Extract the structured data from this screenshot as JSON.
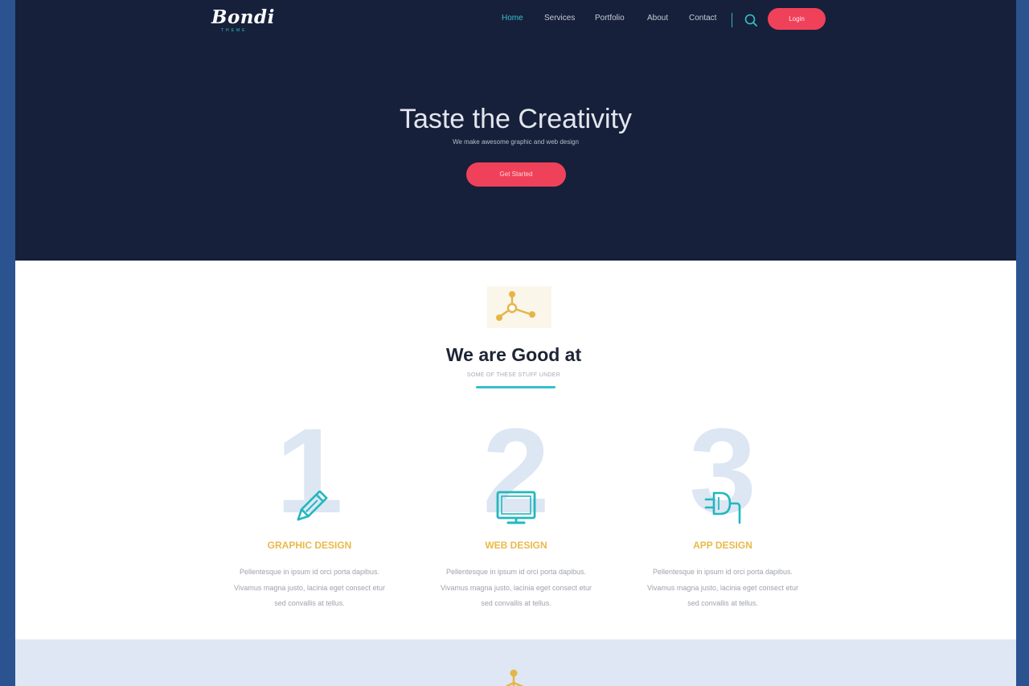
{
  "brand": {
    "name": "Bondi",
    "tagline": "THEME"
  },
  "nav": {
    "items": [
      {
        "label": "Home",
        "active": true
      },
      {
        "label": "Services",
        "active": false
      },
      {
        "label": "Portfolio",
        "active": false
      },
      {
        "label": "About",
        "active": false
      },
      {
        "label": "Contact",
        "active": false
      }
    ],
    "search_icon": "search-icon",
    "login_label": "Login"
  },
  "hero": {
    "title": "Taste the Creativity",
    "subtitle": "We make awesome graphic and web design",
    "cta_label": "Get Started"
  },
  "services": {
    "icon": "network-nodes-icon",
    "title": "We are Good at",
    "subtitle": "SOME OF THESE STUFF UNDER",
    "cards": [
      {
        "number": "1",
        "icon": "pencil-icon",
        "title": "GRAPHIC DESIGN",
        "text": "Pellentesque in ipsum id orci porta dapibus. Vivamus magna justo, lacinia eget consect etur sed convallis at tellus."
      },
      {
        "number": "2",
        "icon": "monitor-icon",
        "title": "WEB DESIGN",
        "text": "Pellentesque in ipsum id orci porta dapibus. Vivamus magna justo, lacinia eget consect etur sed convallis at tellus."
      },
      {
        "number": "3",
        "icon": "plug-icon",
        "title": "APP DESIGN",
        "text": "Pellentesque in ipsum id orci porta dapibus. Vivamus magna justo, lacinia eget consect etur sed convallis at tellus."
      }
    ]
  },
  "colors": {
    "outer_frame": "#2b5390",
    "hero_background": "#17203a",
    "accent_teal": "#35c2cc",
    "accent_red": "#f0415a",
    "accent_gold": "#e9b949",
    "number_watermark": "#dde6f3",
    "next_section_background": "#dfe7f4"
  }
}
